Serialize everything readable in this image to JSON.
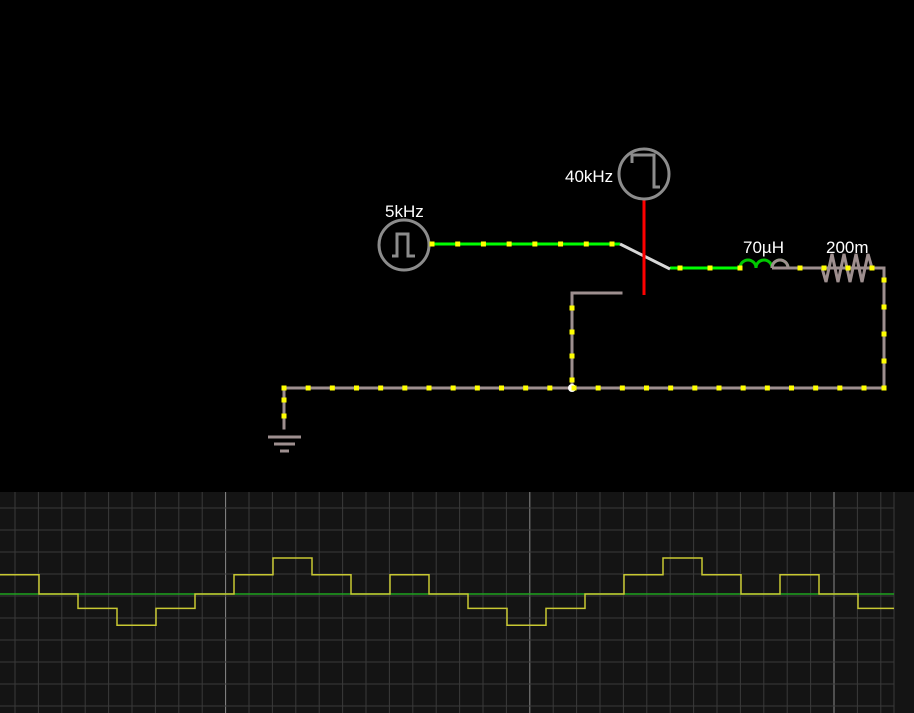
{
  "circuit": {
    "source_5khz_label": "5kHz",
    "source_40khz_label": "40kHz",
    "inductor_label": "70µH",
    "resistor_label": "200m"
  },
  "colors": {
    "background": "#000000",
    "wire_live": "#00ff00",
    "wire_idle": "#9e8f8f",
    "current_dot": "#ffff00",
    "switch_control": "#ff0000",
    "scope_background": "#141414",
    "scope_grid": "#3a3a3a",
    "scope_major_grid": "#8a8a8a",
    "trace_voltage": "#c8c832",
    "trace_zero": "#1fa31f"
  },
  "scope": {
    "trace_levels": [
      0.8,
      0.0,
      -0.6,
      -1.3,
      -0.6,
      0.0,
      0.8,
      1.5,
      0.8,
      0.0
    ]
  }
}
